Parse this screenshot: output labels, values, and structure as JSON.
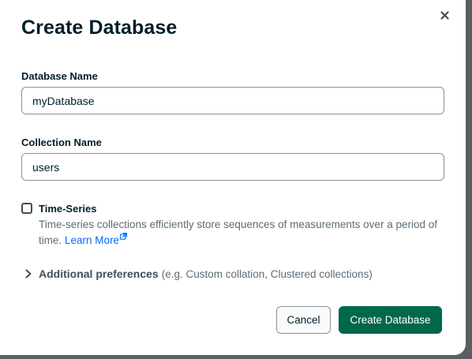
{
  "dialog": {
    "title": "Create Database",
    "close_icon": "close-icon"
  },
  "fields": {
    "database_name": {
      "label": "Database Name",
      "value": "myDatabase"
    },
    "collection_name": {
      "label": "Collection Name",
      "value": "users"
    }
  },
  "time_series": {
    "label": "Time-Series",
    "checked": false,
    "description": "Time-series collections efficiently store sequences of measurements over a period of time.",
    "learn_more": "Learn More",
    "learn_more_icon": "external-link-icon"
  },
  "additional_preferences": {
    "label": "Additional preferences",
    "hint": "(e.g. Custom collation, Clustered collections)",
    "expanded": false,
    "icon": "chevron-right-icon"
  },
  "footer": {
    "cancel_label": "Cancel",
    "create_label": "Create Database"
  },
  "colors": {
    "primary_button": "#00684a",
    "link": "#016bf8",
    "text": "#001e2b",
    "muted_text": "#5c6c75",
    "overlay": "#5b5f62"
  }
}
